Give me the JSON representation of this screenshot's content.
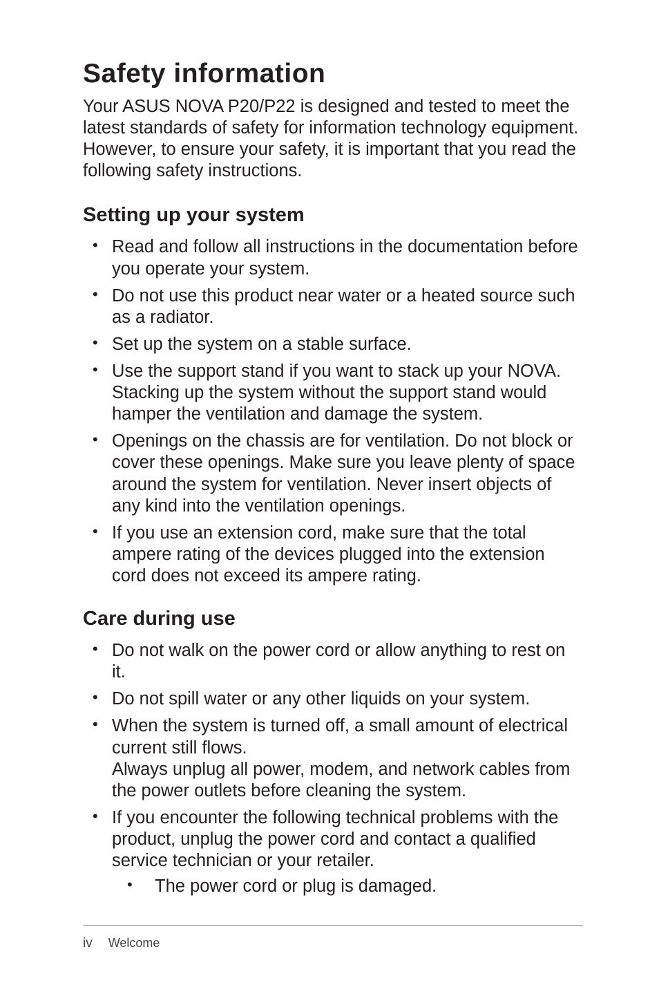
{
  "title": "Safety information",
  "intro": "Your ASUS NOVA P20/P22 is designed and tested to meet the latest standards of safety for information technology equipment. However, to ensure your safety, it is important that you read the following safety instructions.",
  "section1": {
    "heading": "Setting up your system",
    "items": [
      "Read and follow all instructions in the documentation before you operate your system.",
      "Do not use this product near water or a heated source such as a radiator.",
      "Set up the system on a stable surface.",
      "Use the support stand if you want to stack up your NOVA. Stacking up the system without the support stand would hamper the ventilation and damage the system.",
      "Openings on the chassis are for ventilation. Do not block or cover these openings. Make sure you leave plenty of space around the system for ventilation. Never insert objects of any kind into the ventilation openings.",
      "If you use an extension cord, make sure that the total ampere rating of the devices plugged into the extension cord does not exceed its ampere rating."
    ]
  },
  "section2": {
    "heading": "Care during use",
    "items": [
      "Do not walk on the power cord or allow anything to rest on it.",
      "Do not spill water or any other liquids on your system."
    ],
    "item3_line1": "When the system is turned off, a small amount of electrical current still flows.",
    "item3_line2": "Always unplug all power, modem, and network cables from the power outlets before cleaning the system.",
    "item4": "If you encounter the following technical problems with the product, unplug the power cord and contact a qualified service technician or your retailer.",
    "subitems": [
      "The power cord or plug is damaged."
    ]
  },
  "footer": {
    "page": "iv",
    "section": "Welcome"
  }
}
